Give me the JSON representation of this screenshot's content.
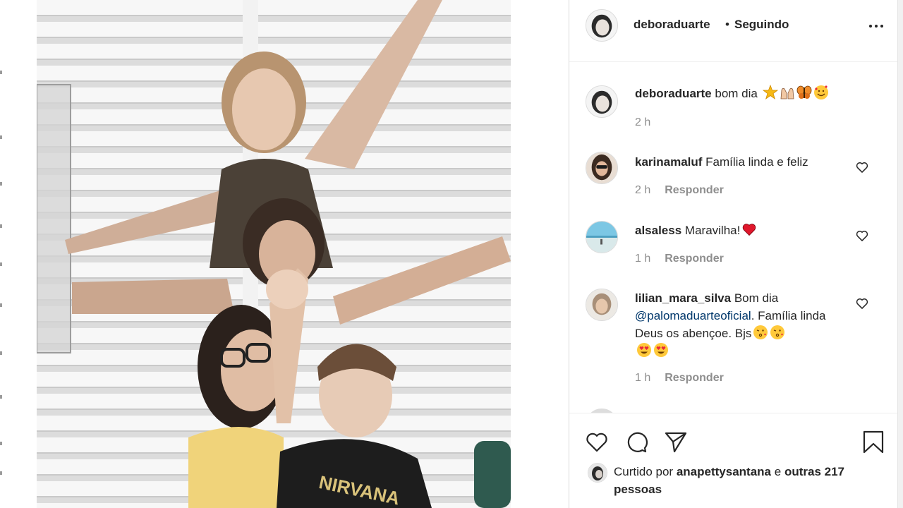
{
  "post": {
    "username": "deboraduarte",
    "separator": "•",
    "follow_status": "Seguindo",
    "caption": {
      "username": "deboraduarte",
      "text": "bom dia",
      "emojis": [
        "star-emoji",
        "raising-hands-emoji",
        "butterfly-emoji",
        "smiling-hearts-emoji"
      ],
      "time": "2 h"
    }
  },
  "comments": [
    {
      "username": "karinamaluf",
      "text": "Família linda e feliz",
      "time": "2 h",
      "reply": "Responder"
    },
    {
      "username": "alsaless",
      "text": "Maravilha!",
      "time": "1 h",
      "reply": "Responder",
      "emojis": [
        "red-heart-emoji"
      ]
    },
    {
      "username": "lilian_mara_silva",
      "text_before": "Bom dia",
      "mention": "@palomaduarteoficial",
      "text_after": ". Família linda Deus os abençoe. Bjs",
      "time": "1 h",
      "reply": "Responder",
      "emojis": [
        "kiss-emoji",
        "kiss-emoji",
        "heart-eyes-emoji",
        "heart-eyes-emoji"
      ]
    }
  ],
  "likes": {
    "prefix": "Curtido por",
    "liker": "anapettysantana",
    "connector": "e",
    "others": "outras 217 pessoas"
  },
  "colors": {
    "text": "#262626",
    "secondary": "#8e8e8e",
    "link": "#00376b",
    "divider": "#dbdbdb"
  }
}
